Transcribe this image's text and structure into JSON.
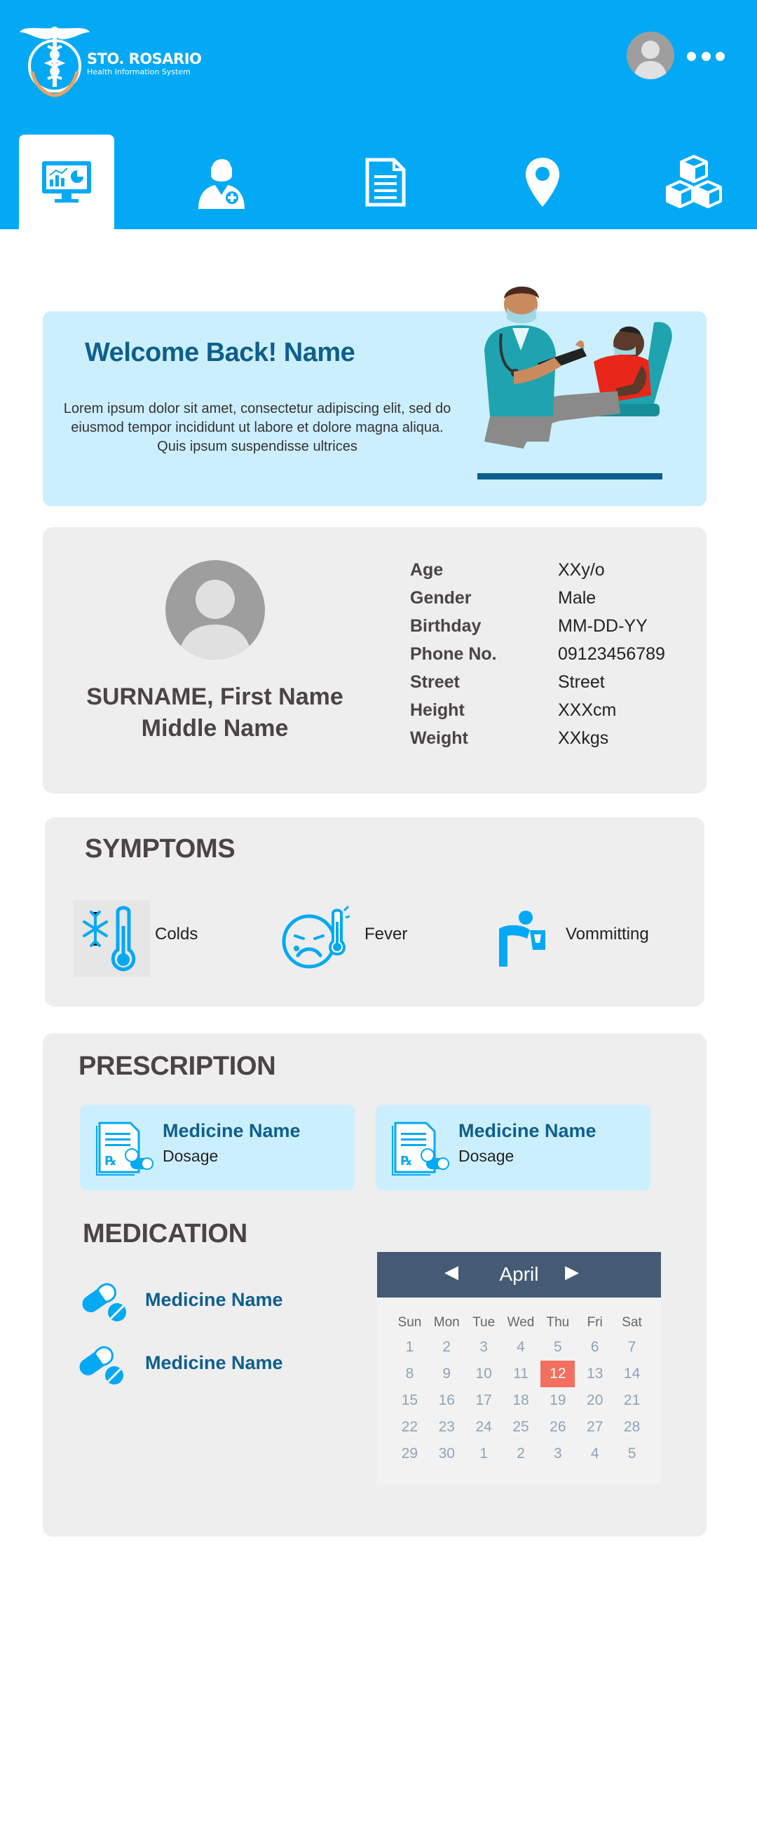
{
  "app": {
    "brand_name": "STO. ROSARIO",
    "brand_subtitle": "Health Information System",
    "logo_text": "Sto. Rosario"
  },
  "header": {
    "nav_tabs": [
      {
        "icon": "dashboard-monitor-icon",
        "active": true
      },
      {
        "icon": "doctor-icon",
        "active": false
      },
      {
        "icon": "document-icon",
        "active": false
      },
      {
        "icon": "location-pin-icon",
        "active": false
      },
      {
        "icon": "inventory-boxes-icon",
        "active": false
      }
    ]
  },
  "welcome": {
    "title": "Welcome Back! Name",
    "text": "Lorem ipsum dolor sit amet, consectetur adipiscing elit, sed do eiusmod tempor incididunt ut labore et dolore magna aliqua. Quis ipsum suspendisse ultrices"
  },
  "profile": {
    "name_line1": "SURNAME, First Name",
    "name_line2": "Middle Name",
    "fields": [
      {
        "label": "Age",
        "value": "XXy/o"
      },
      {
        "label": "Gender",
        "value": "Male"
      },
      {
        "label": "Birthday",
        "value": "MM-DD-YY"
      },
      {
        "label": "Phone No.",
        "value": "09123456789"
      },
      {
        "label": "Street",
        "value": "Street"
      },
      {
        "label": "Height",
        "value": "XXXcm"
      },
      {
        "label": "Weight",
        "value": "XXkgs"
      }
    ]
  },
  "symptoms": {
    "title": "SYMPTOMS",
    "items": [
      {
        "label": "Colds",
        "icon": "cold-thermometer-icon"
      },
      {
        "label": "Fever",
        "icon": "fever-face-icon"
      },
      {
        "label": "Vommitting",
        "icon": "vomiting-person-icon"
      }
    ]
  },
  "prescription": {
    "title": "PRESCRIPTION",
    "items": [
      {
        "name": "Medicine Name",
        "dosage": "Dosage"
      },
      {
        "name": "Medicine Name",
        "dosage": "Dosage"
      }
    ]
  },
  "medication": {
    "title": "MEDICATION",
    "items": [
      {
        "name": "Medicine Name"
      },
      {
        "name": "Medicine Name"
      }
    ]
  },
  "calendar": {
    "month": "April",
    "prev_symbol": "◀",
    "next_symbol": "▶",
    "weekdays": [
      "Sun",
      "Mon",
      "Tue",
      "Wed",
      "Thu",
      "Fri",
      "Sat"
    ],
    "days": [
      "1",
      "2",
      "3",
      "4",
      "5",
      "6",
      "7",
      "8",
      "9",
      "10",
      "11",
      "12",
      "13",
      "14",
      "15",
      "16",
      "17",
      "18",
      "19",
      "20",
      "21",
      "22",
      "23",
      "24",
      "25",
      "26",
      "27",
      "28",
      "29",
      "30",
      "1",
      "2",
      "3",
      "4",
      "5"
    ],
    "today": "12",
    "today_color": "#f36f5e"
  },
  "colors": {
    "primary": "#03a9f4",
    "accent_dark": "#0e5f8c",
    "light_blue": "#cceffd"
  }
}
